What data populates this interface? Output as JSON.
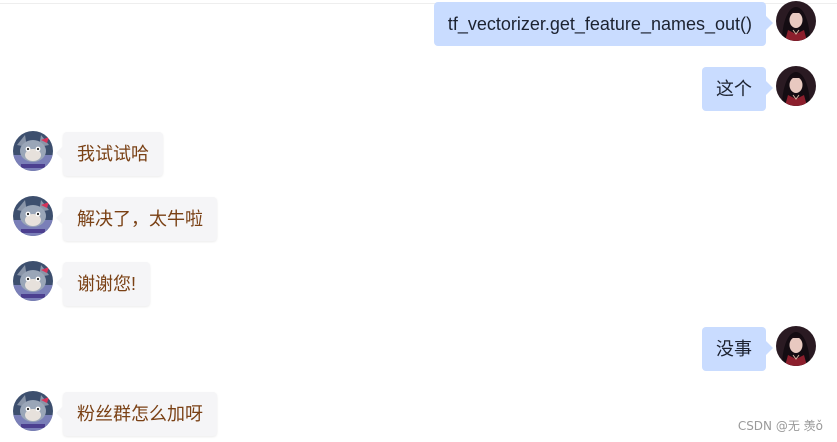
{
  "messages": [
    {
      "side": "right",
      "text": "tf_vectorizer.get_feature_names_out()"
    },
    {
      "side": "right",
      "text": "这个"
    },
    {
      "side": "left",
      "text": "我试试哈"
    },
    {
      "side": "left",
      "text": "解决了，太牛啦"
    },
    {
      "side": "left",
      "text": "谢谢您!"
    },
    {
      "side": "right",
      "text": "没事"
    },
    {
      "side": "left",
      "text": "粉丝群怎么加呀"
    }
  ],
  "watermark": "CSDN @无 羡ǒ",
  "colors": {
    "right_bubble": "#c9dcff",
    "left_bubble": "#f5f5f7",
    "left_text": "#7a4115"
  },
  "icons": {
    "right_avatar": "dark-haired-character-avatar",
    "left_avatar": "cartoon-cat-avatar"
  }
}
